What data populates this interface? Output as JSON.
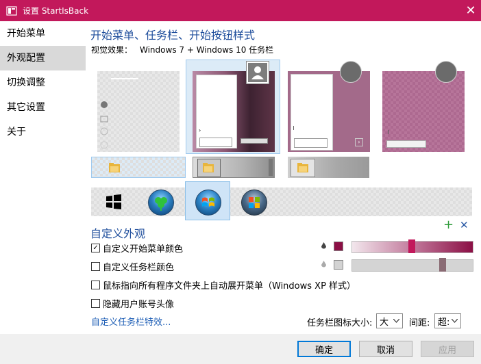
{
  "window": {
    "title": "设置 StartIsBack",
    "close_symbol": "✕"
  },
  "sidebar": {
    "items": [
      {
        "label": "开始菜单",
        "active": false
      },
      {
        "label": "外观配置",
        "active": true
      },
      {
        "label": "切换调整",
        "active": false
      },
      {
        "label": "其它设置",
        "active": false
      },
      {
        "label": "关于",
        "active": false
      }
    ]
  },
  "main": {
    "section_title": "开始菜单、任务栏、开始按钮样式",
    "visual_effect": {
      "label": "视觉效果：",
      "value": "Windows 7 + Windows 10 任务栏"
    },
    "styles": {
      "selected_index": 1
    },
    "orbs": {
      "selected_index": 2
    },
    "custom": {
      "title": "自定义外观",
      "add_symbol": "+",
      "remove_symbol": "✕",
      "start_color": {
        "label": "自定义开始菜单颜色",
        "checked": true,
        "color": "#8b0f45",
        "check_mark": "✓",
        "slider_level": 0.5
      },
      "taskbar_color": {
        "label": "自定义任务栏颜色",
        "checked": false,
        "color": "#d3d3d3",
        "slider_level": 0.75
      },
      "xp_style": {
        "label": "鼠标指向所有程序文件夹上自动展开菜单（Windows XP 样式）",
        "checked": false
      },
      "hide_avatar": {
        "label": "隐藏用户账号头像",
        "checked": false
      },
      "taskbar_effects_link": "自定义任务栏特效...",
      "icon_size": {
        "label": "任务栏图标大小:",
        "value": "大"
      },
      "spacing": {
        "label": "间距:",
        "value": "超:"
      }
    }
  },
  "footer": {
    "ok": "确定",
    "cancel": "取消",
    "apply": "应用"
  },
  "colors": {
    "accent": "#c2185b",
    "heading": "#1f4e9c",
    "link": "#1f5fb6",
    "selection": "#0078d7"
  }
}
